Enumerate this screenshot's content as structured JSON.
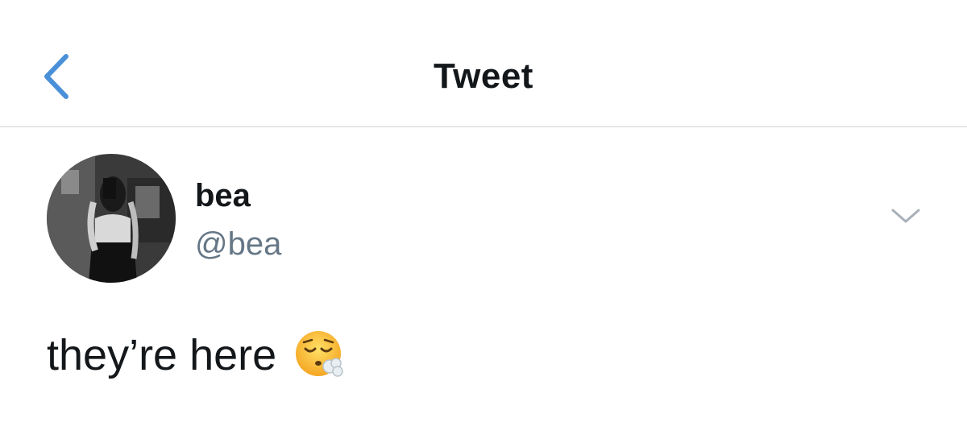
{
  "nav": {
    "title": "Tweet",
    "back_icon": "chevron-left-icon",
    "accent_color": "#4a90d9"
  },
  "tweet": {
    "author": {
      "display_name": "bea",
      "handle": "@bea",
      "avatar_icon": "avatar-photo"
    },
    "text": "they’re here",
    "emoji": "face-exhaling-emoji",
    "more_icon": "chevron-down-icon",
    "handle_color": "#657786"
  }
}
